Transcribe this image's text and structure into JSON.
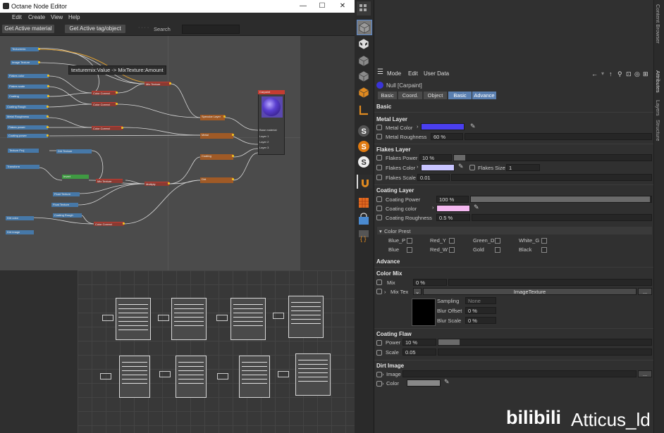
{
  "window": {
    "title": "Octane Node Editor",
    "minimize": "—",
    "maximize": "☐",
    "close": "✕"
  },
  "menu": [
    "Edit",
    "Create",
    "View",
    "Help"
  ],
  "toolbar": {
    "get_active_material": "Get Active material",
    "get_active_tag": "Get Active tag/object",
    "search_label": "Search",
    "search_value": ""
  },
  "tooltip": "texturemix:Value  ->  MixTexture:Amount",
  "nodes": {
    "n1": "Texturemix",
    "n2": "Image Texture",
    "n3": "Flakes color",
    "n4": "Flakes scale",
    "n5": "Coating",
    "n6": "Coating Rough",
    "n7": "Metal Roughness",
    "n8": "Flakes power",
    "n9": "Coating power",
    "n10": "Texture Proj",
    "n11": "Transform",
    "n12": "Dirt color",
    "n13": "Dirt image",
    "c1": "Color Correct",
    "c2": "Color Correct",
    "c3": "Color Correct",
    "c4": "Mix Texture",
    "c5": "Mix Texture",
    "c6": "Multiply",
    "c7": "Color Correct",
    "c8": "Dirt Texture",
    "o1": "Specular Layer",
    "o2": "Metal",
    "o3": "Coating",
    "o4": "Dirt",
    "g1": "Invert",
    "b1": "Float Texture",
    "b2": "Float Texture",
    "b3": "Coating Rough",
    "out": "Carpaint",
    "out_p1": "Base material",
    "out_p2": "Layer 1",
    "out_p3": "Layer 2",
    "out_p4": "Layer 3"
  },
  "attributes": {
    "menu": [
      "Mode",
      "Edit",
      "User Data"
    ],
    "object_name": "Null [Carpaint]",
    "tabs": [
      "Basic",
      "Coord.",
      "Object",
      "Basic",
      "Advance"
    ],
    "basic_header": "Basic",
    "metal_layer": {
      "header": "Metal Layer",
      "metal_color_label": "Metal Color",
      "metal_color": "#4a3ff0",
      "metal_roughness_label": "Metal Roughness",
      "metal_roughness": "60 %"
    },
    "flakes_layer": {
      "header": "Flakes Layer",
      "flakes_power_label": "Flakes Power",
      "flakes_power": "10 %",
      "flakes_color_label": "Flakes Color",
      "flakes_color": "#c8c4ff",
      "flakes_size_label": "Flakes Size",
      "flakes_size": "1",
      "flakes_scale_label": "Flakes Scale",
      "flakes_scale": "0.01"
    },
    "coating_layer": {
      "header": "Coating Layer",
      "coating_power_label": "Coating Power",
      "coating_power": "100 %",
      "coating_color_label": "Coating color",
      "coating_color": "#f4b8f0",
      "coating_roughness_label": "Coating Roughness",
      "coating_roughness": "0.5 %"
    },
    "color_preset": {
      "header": "Color Prest",
      "items": [
        "Blue_P",
        "Red_Y",
        "Green_D",
        "White_G",
        "Blue",
        "Red_W",
        "Gold",
        "Black"
      ]
    },
    "advance_header": "Advance",
    "color_mix": {
      "header": "Color Mix",
      "mix_label": "Mix",
      "mix": "0 %",
      "mix_tex_label": "Mix Tex",
      "mix_tex_value": "ImageTexture",
      "more": "...",
      "sampling_label": "Sampling",
      "sampling": "None",
      "blur_offset_label": "Blur Offset",
      "blur_offset": "0 %",
      "blur_scale_label": "Blur Scale",
      "blur_scale": "0 %"
    },
    "coating_flaw": {
      "header": "Coating Flaw",
      "power_label": "Power",
      "power": "10 %",
      "scale_label": "Scale",
      "scale": "0.05"
    },
    "dirt_image": {
      "header": "Dirt Image",
      "image_label": "Image",
      "more": "...",
      "color_label": "Color",
      "color": "#888888"
    }
  },
  "side_tabs": [
    "Content Browser",
    "Attributes",
    "Layers",
    "Structure"
  ],
  "watermark": {
    "brand": "bilibili",
    "user": "Atticus_ld"
  }
}
